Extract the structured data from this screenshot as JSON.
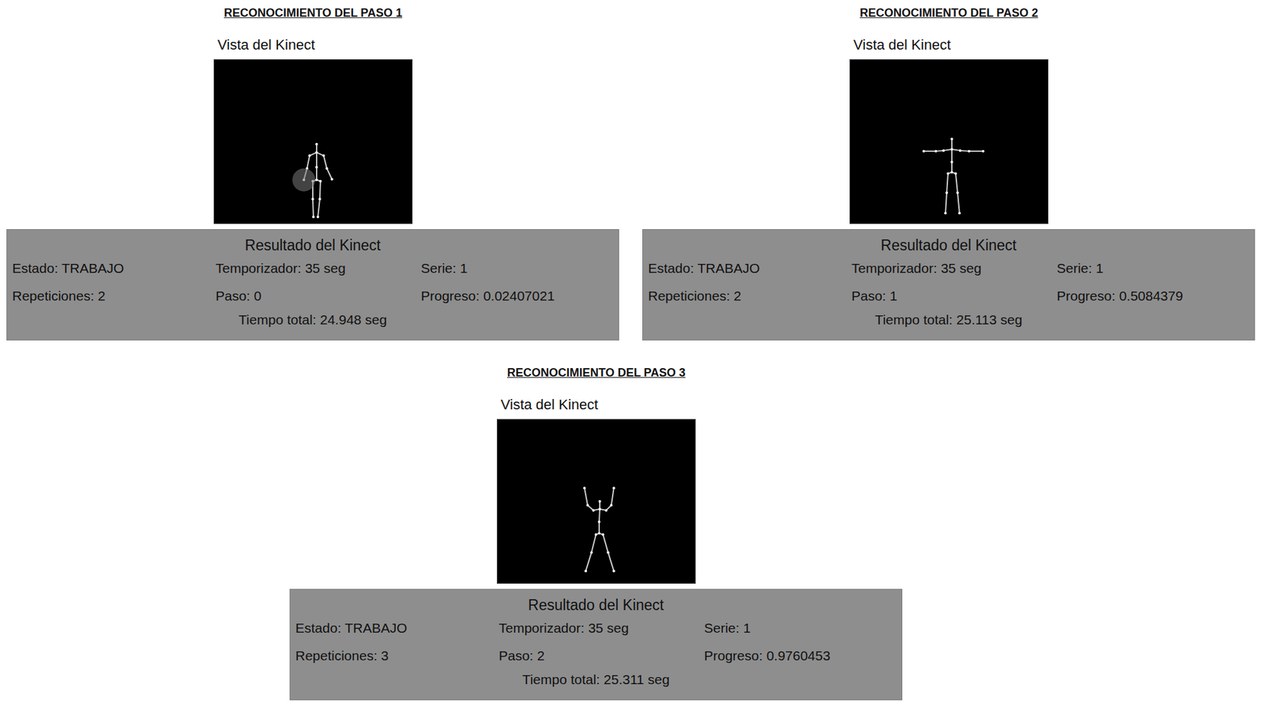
{
  "panels": [
    {
      "title": "RECONOCIMIENTO DEL PASO 1",
      "view_label": "Vista del Kinect",
      "pose": "arms-down",
      "hand_marker": true,
      "result": {
        "title": "Resultado del Kinect",
        "rows": [
          [
            "Estado: TRABAJO",
            "Temporizador: 35 seg",
            "Serie: 1"
          ],
          [
            "Repeticiones: 2",
            "Paso: 0",
            "Progreso: 0.02407021"
          ]
        ],
        "total": "Tiempo total: 24.948 seg"
      }
    },
    {
      "title": "RECONOCIMIENTO DEL PASO 2",
      "view_label": "Vista del Kinect",
      "pose": "arms-out",
      "hand_marker": false,
      "result": {
        "title": "Resultado del Kinect",
        "rows": [
          [
            "Estado: TRABAJO",
            "Temporizador: 35 seg",
            "Serie: 1"
          ],
          [
            "Repeticiones: 2",
            "Paso: 1",
            "Progreso: 0.5084379"
          ]
        ],
        "total": "Tiempo total: 25.113 seg"
      }
    },
    {
      "title": "RECONOCIMIENTO DEL PASO 3",
      "view_label": "Vista del Kinect",
      "pose": "arms-up",
      "hand_marker": false,
      "result": {
        "title": "Resultado del Kinect",
        "rows": [
          [
            "Estado: TRABAJO",
            "Temporizador: 35 seg",
            "Serie: 1"
          ],
          [
            "Repeticiones: 3",
            "Paso: 2",
            "Progreso: 0.9760453"
          ]
        ],
        "total": "Tiempo total: 25.311 seg"
      }
    }
  ]
}
